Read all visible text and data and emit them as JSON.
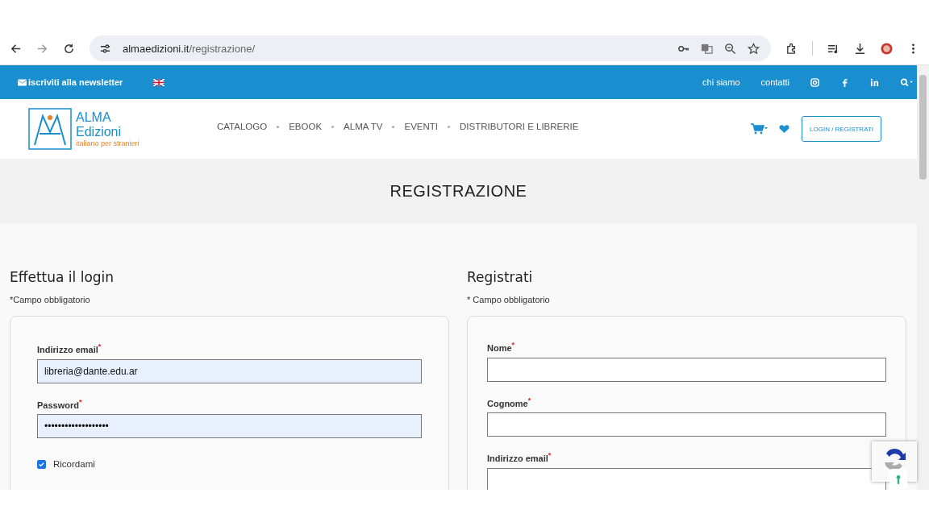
{
  "browser": {
    "url_host": "almaedizioni.it",
    "url_path": "/registrazione/"
  },
  "topbar": {
    "newsletter": "iscriviti alla newsletter",
    "links": [
      "chi siamo",
      "contatti"
    ]
  },
  "header": {
    "logo_title": "ALMA",
    "logo_subtitle": "Edizioni",
    "logo_tagline": "italiano per stranieri",
    "nav": [
      "CATALOGO",
      "EBOOK",
      "ALMA TV",
      "EVENTI",
      "DISTRIBUTORI E LIBRERIE"
    ],
    "login_button": "LOGIN / REGISTRATI"
  },
  "page_title": "REGISTRAZIONE",
  "login": {
    "heading": "Effettua il login",
    "required_note": "*Campo obbligatorio",
    "fields": [
      {
        "label": "Indirizzo email",
        "required_mark": "*",
        "value": "libreria@dante.edu.ar",
        "autofilled": true
      },
      {
        "label": "Password",
        "required_mark": "*",
        "value": "•••••••••••••••••••",
        "autofilled": true
      }
    ],
    "remember": {
      "label": "Ricordami",
      "checked": true
    }
  },
  "register": {
    "heading": "Registrati",
    "required_note": "* Campo obbligatorio",
    "fields": [
      {
        "label": "Nome",
        "required_mark": "*",
        "autofilled": false
      },
      {
        "label": "Cognome",
        "required_mark": "*",
        "autofilled": false
      },
      {
        "label": "Indirizzo email",
        "required_mark": "*",
        "autofilled": false
      }
    ]
  }
}
